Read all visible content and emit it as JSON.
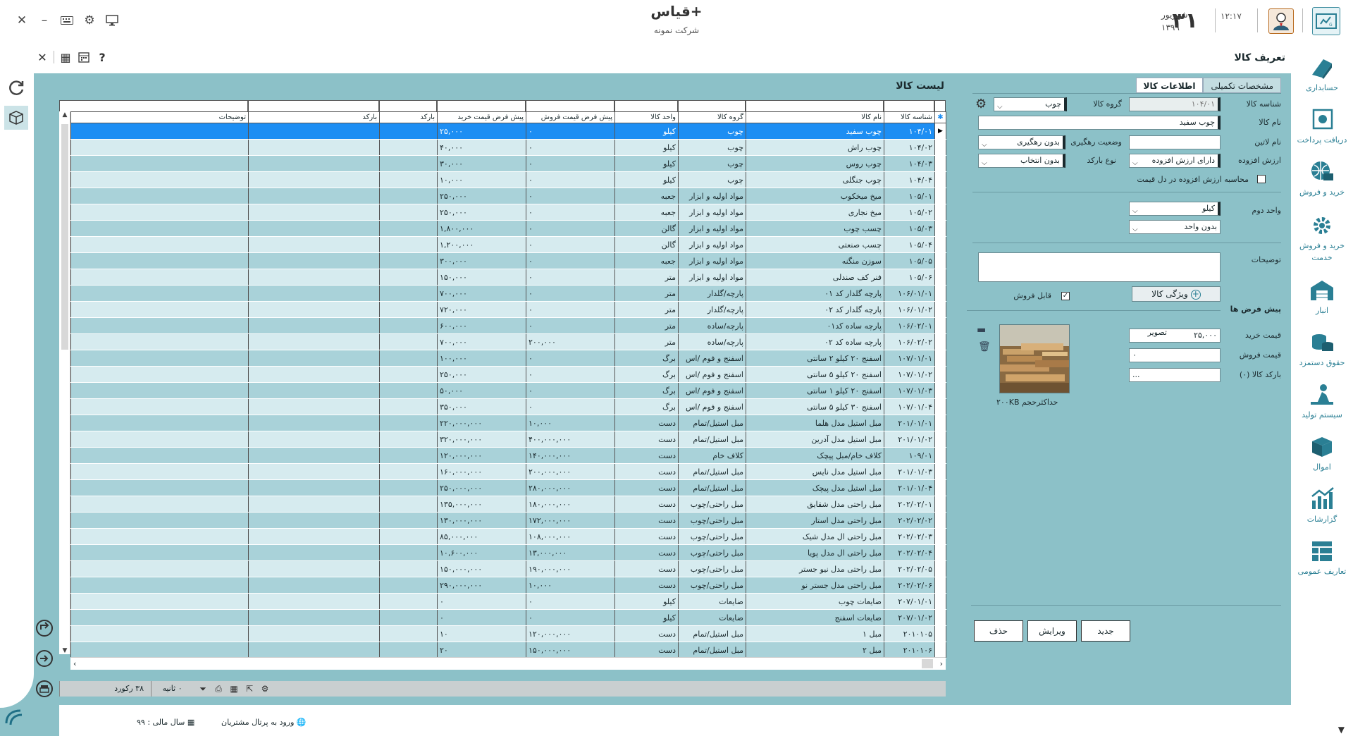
{
  "window": {
    "app_title": "قیاس+",
    "company": "شرکت نمونه"
  },
  "datetime": {
    "day": "۳۱",
    "month": "شهریور",
    "year": "۱۳۹۹",
    "time": "۱۲:۱۷"
  },
  "page": {
    "title": "تعریف کالا"
  },
  "right_nav": [
    {
      "label": "حسابداری",
      "icon": "accounting-icon"
    },
    {
      "label": "دریافت پرداخت",
      "icon": "payment-icon"
    },
    {
      "label": "خرید و فروش",
      "icon": "buy-sell-icon"
    },
    {
      "label": "خرید و فروش خدمت",
      "icon": "service-icon"
    },
    {
      "label": "انبار",
      "icon": "warehouse-icon"
    },
    {
      "label": "حقوق دستمزد",
      "icon": "payroll-icon"
    },
    {
      "label": "سیستم تولید",
      "icon": "production-icon"
    },
    {
      "label": "اموال",
      "icon": "assets-icon"
    },
    {
      "label": "گزارشات",
      "icon": "reports-icon"
    },
    {
      "label": "تعاریف عمومی",
      "icon": "definitions-icon"
    }
  ],
  "grid": {
    "caption": "لیست کالا",
    "columns": [
      "شناسه کالا",
      "نام کالا",
      "گروه کالا",
      "واحد کالا",
      "پیش فرض قیمت فروش",
      "پیش فرض قیمت خرید",
      "بارکد",
      "بارکد",
      "توضیحات"
    ],
    "rows": [
      [
        "۱۰۴/۰۱",
        "چوب سفید",
        "چوب",
        "کیلو",
        "۰",
        "۲۵,۰۰۰"
      ],
      [
        "۱۰۴/۰۲",
        "چوب راش",
        "چوب",
        "کیلو",
        "۰",
        "۴۰,۰۰۰"
      ],
      [
        "۱۰۴/۰۳",
        "چوب روس",
        "چوب",
        "کیلو",
        "۰",
        "۳۰,۰۰۰"
      ],
      [
        "۱۰۴/۰۴",
        "چوب جنگلی",
        "چوب",
        "کیلو",
        "۰",
        "۱۰,۰۰۰"
      ],
      [
        "۱۰۵/۰۱",
        "میخ میخکوب",
        "مواد اولیه و ابزار",
        "جعبه",
        "۰",
        "۲۵۰,۰۰۰"
      ],
      [
        "۱۰۵/۰۲",
        "میخ نجاری",
        "مواد اولیه و ابزار",
        "جعبه",
        "۰",
        "۲۵۰,۰۰۰"
      ],
      [
        "۱۰۵/۰۳",
        "چسب چوب",
        "مواد اولیه و ابزار",
        "گالن",
        "۰",
        "۱,۸۰۰,۰۰۰"
      ],
      [
        "۱۰۵/۰۴",
        "چسب صنعتی",
        "مواد اولیه و ابزار",
        "گالن",
        "۰",
        "۱,۲۰۰,۰۰۰"
      ],
      [
        "۱۰۵/۰۵",
        "سوزن منگنه",
        "مواد اولیه و ابزار",
        "جعبه",
        "۰",
        "۳۰۰,۰۰۰"
      ],
      [
        "۱۰۵/۰۶",
        "فنر کف صندلی",
        "مواد اولیه و ابزار",
        "متر",
        "۰",
        "۱۵۰,۰۰۰"
      ],
      [
        "۱۰۶/۰۱/۰۱",
        "پارچه گلدار کد ۰۱",
        "پارچه/گلدار",
        "متر",
        "۰",
        "۷۰۰,۰۰۰"
      ],
      [
        "۱۰۶/۰۱/۰۲",
        "پارچه گلدار کد ۰۲",
        "پارچه/گلدار",
        "متر",
        "۰",
        "۷۲۰,۰۰۰"
      ],
      [
        "۱۰۶/۰۲/۰۱",
        "پارچه ساده کد۰۱",
        "پارچه/ساده",
        "متر",
        "۰",
        "۶۰۰,۰۰۰"
      ],
      [
        "۱۰۶/۰۲/۰۲",
        "پارچه ساده کد ۰۲",
        "پارچه/ساده",
        "متر",
        "۲۰۰,۰۰۰",
        "۷۰۰,۰۰۰"
      ],
      [
        "۱۰۷/۰۱/۰۱",
        "اسفنج ۲۰ کیلو ۲ سانتی",
        "اسفنج و فوم /اس",
        "برگ",
        "۰",
        "۱۰۰,۰۰۰"
      ],
      [
        "۱۰۷/۰۱/۰۲",
        "اسفنج ۲۰ کیلو ۵ سانتی",
        "اسفنج و فوم /اس",
        "برگ",
        "۰",
        "۲۵۰,۰۰۰"
      ],
      [
        "۱۰۷/۰۱/۰۳",
        "اسفنج ۲۰ کیلو ۱ سانتی",
        "اسفنج و فوم /اس",
        "برگ",
        "۰",
        "۵۰,۰۰۰"
      ],
      [
        "۱۰۷/۰۱/۰۴",
        "اسفنج ۳۰ کیلو ۵ سانتی",
        "اسفنج و فوم /اس",
        "برگ",
        "۰",
        "۳۵۰,۰۰۰"
      ],
      [
        "۲۰۱/۰۱/۰۱",
        "مبل استیل مدل هلما",
        "مبل استیل/تمام",
        "دست",
        "۱۰,۰۰۰",
        "۲۲۰,۰۰۰,۰۰۰"
      ],
      [
        "۲۰۱/۰۱/۰۲",
        "مبل استیل مدل آدرین",
        "مبل استیل/تمام",
        "دست",
        "۴۰۰,۰۰۰,۰۰۰",
        "۳۲۰,۰۰۰,۰۰۰"
      ],
      [
        "۱۰۹/۰۱",
        "کلاف خام/مبل پیچک",
        "کلاف خام",
        "دست",
        "۱۴۰,۰۰۰,۰۰۰",
        "۱۲۰,۰۰۰,۰۰۰"
      ],
      [
        "۲۰۱/۰۱/۰۳",
        "مبل استیل مدل نایس",
        "مبل استیل/تمام",
        "دست",
        "۲۰۰,۰۰۰,۰۰۰",
        "۱۶۰,۰۰۰,۰۰۰"
      ],
      [
        "۲۰۱/۰۱/۰۴",
        "مبل استیل مدل پیچک",
        "مبل استیل/تمام",
        "دست",
        "۲۸۰,۰۰۰,۰۰۰",
        "۲۵۰,۰۰۰,۰۰۰"
      ],
      [
        "۲۰۲/۰۲/۰۱",
        "مبل راحتی مدل شقایق",
        "مبل راحتی/چوب",
        "دست",
        "۱۸۰,۰۰۰,۰۰۰",
        "۱۳۵,۰۰۰,۰۰۰"
      ],
      [
        "۲۰۲/۰۲/۰۲",
        "مبل راحتی مدل استار",
        "مبل راحتی/چوب",
        "دست",
        "۱۷۲,۰۰۰,۰۰۰",
        "۱۳۰,۰۰۰,۰۰۰"
      ],
      [
        "۲۰۲/۰۲/۰۳",
        "مبل راحتی ال مدل شیک",
        "مبل راحتی/چوب",
        "دست",
        "۱۰۸,۰۰۰,۰۰۰",
        "۸۵,۰۰۰,۰۰۰"
      ],
      [
        "۲۰۲/۰۲/۰۴",
        "مبل راحتی ال مدل پویا",
        "مبل راحتی/چوب",
        "دست",
        "۱۳,۰۰۰,۰۰۰",
        "۱۰,۶۰۰,۰۰۰"
      ],
      [
        "۲۰۲/۰۲/۰۵",
        "مبل راحتی مدل نیو جستر",
        "مبل راحتی/چوب",
        "دست",
        "۱۹۰,۰۰۰,۰۰۰",
        "۱۵۰,۰۰۰,۰۰۰"
      ],
      [
        "۲۰۲/۰۲/۰۶",
        "مبل راحتی مدل جستر نو",
        "مبل راحتی/چوب",
        "دست",
        "۱۰,۰۰۰",
        "۲۹۰,۰۰۰,۰۰۰"
      ],
      [
        "۲۰۷/۰۱/۰۱",
        "ضایعات چوب",
        "ضایعات",
        "کیلو",
        "۰",
        "۰"
      ],
      [
        "۲۰۷/۰۱/۰۲",
        "ضایعات اسفنج",
        "ضایعات",
        "کیلو",
        "۰",
        "۰"
      ],
      [
        "۲۰۱۰۱۰۵",
        "مبل ۱",
        "مبل استیل/تمام",
        "دست",
        "۱۲۰,۰۰۰,۰۰۰",
        "۱۰"
      ],
      [
        "۲۰۱۰۱۰۶",
        "مبل ۲",
        "مبل استیل/تمام",
        "دست",
        "۱۵۰,۰۰۰,۰۰۰",
        "۲۰"
      ]
    ],
    "record_count": "۳۸ رکورد",
    "duration": "۰ ثانیه"
  },
  "form": {
    "tabs": {
      "info": "اطلاعات کالا",
      "extra": "مشخصات تکمیلی"
    },
    "code_label": "شناسه کالا",
    "code_value": "۱۰۴/۰۱",
    "group_label": "گروه کالا",
    "group_value": "چوب",
    "name_label": "نام کالا",
    "name_value": "چوب سفید",
    "latin_label": "نام لاتین",
    "latin_value": "",
    "tracking_label": "وضعیت رهگیری",
    "tracking_value": "بدون رهگیری",
    "vat_label": "ارزش افزوده",
    "vat_value": "دارای ارزش افزوده",
    "barcode_type_label": "نوع بارکد",
    "barcode_type_value": "بدون انتخاب",
    "vat_in_price_label": "محاسبه ارزش افزوده در دل قیمت",
    "unit2_label": "واحد دوم",
    "unit1_value": "کیلو",
    "unit2_value": "بدون واحد",
    "desc_label": "توضیحات",
    "attr_button": "ویژگی کالا",
    "sellable_label": "قابل فروش",
    "defaults_label": "پیش فرض ها",
    "buy_price_label": "قیمت خرید",
    "buy_price_value": "۲۵,۰۰۰",
    "sell_price_label": "قیمت فروش",
    "sell_price_value": "۰",
    "barcode_label": "بارکد کالا (۰)",
    "barcode_value": "...",
    "image_label": "تصویر",
    "max_size_label": "حداکثرحجم ۲۰۰KB",
    "new_btn": "جدید",
    "edit_btn": "ویرایش",
    "delete_btn": "حذف"
  },
  "footer": {
    "portal_link": "ورود به پرتال مشتریان",
    "fiscal_year": "سال مالی : ۹۹"
  },
  "colors": {
    "panel": "#8cc1c8",
    "row_odd": "#a9d2d9",
    "row_even": "#d6ebef",
    "selected": "#1d8ef3",
    "accent": "#2a7f94"
  }
}
